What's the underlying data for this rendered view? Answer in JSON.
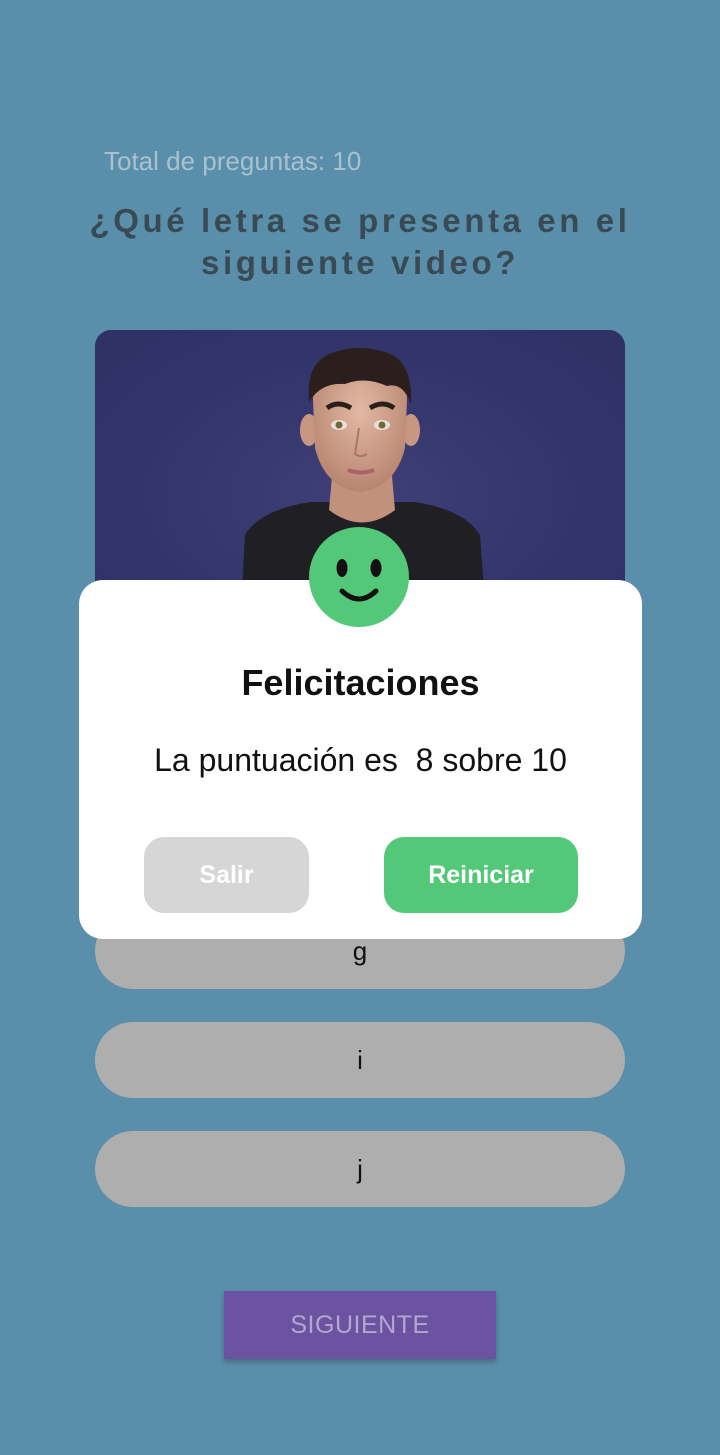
{
  "header": {
    "total_label": "Total de preguntas: 10",
    "question": "¿Qué letra se presenta en el siguiente video?"
  },
  "video": {
    "content": "avatar-signing-letter"
  },
  "options": [
    {
      "label": "g"
    },
    {
      "label": "i"
    },
    {
      "label": "j"
    }
  ],
  "next_button": {
    "label": "SIGUIENTE"
  },
  "dialog": {
    "title": "Felicitaciones",
    "score_text": "La puntuación es  8 sobre 10",
    "exit_label": "Salir",
    "restart_label": "Reiniciar",
    "icon": "smiley-face-icon"
  },
  "colors": {
    "background": "#5a8fab",
    "accent_green": "#52c878",
    "next_purple": "#6c53a1",
    "option_gray": "#aeaeae"
  }
}
